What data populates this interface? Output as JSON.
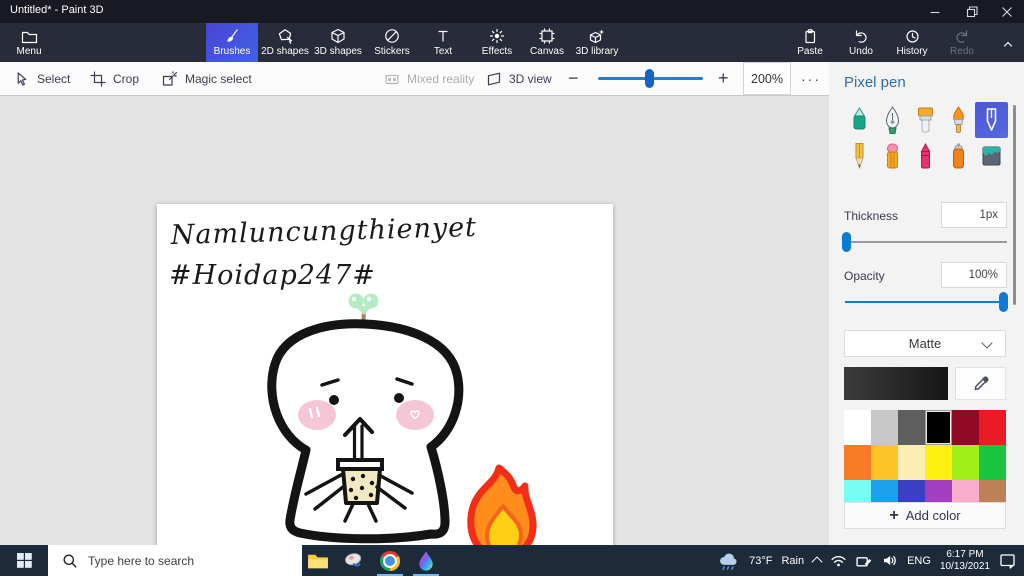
{
  "window": {
    "title": "Untitled* - Paint 3D"
  },
  "ribbon": {
    "menu_label": "Menu",
    "tools": [
      {
        "label": "Brushes",
        "icon": "brush-icon",
        "selected": true
      },
      {
        "label": "2D shapes",
        "icon": "2d-shapes-icon"
      },
      {
        "label": "3D shapes",
        "icon": "3d-shapes-icon"
      },
      {
        "label": "Stickers",
        "icon": "stickers-icon"
      },
      {
        "label": "Text",
        "icon": "text-icon"
      },
      {
        "label": "Effects",
        "icon": "effects-icon"
      },
      {
        "label": "Canvas",
        "icon": "canvas-icon"
      },
      {
        "label": "3D library",
        "icon": "3d-library-icon"
      }
    ],
    "paste_label": "Paste",
    "undo_label": "Undo",
    "history_label": "History",
    "redo_label": "Redo"
  },
  "toolbar": {
    "select_label": "Select",
    "crop_label": "Crop",
    "magic_label": "Magic select",
    "mixed_label": "Mixed reality",
    "view3d_label": "3D view",
    "zoom_value": "200%",
    "zoom_out_glyph": "−",
    "zoom_in_glyph": "+",
    "more_glyph": "···"
  },
  "canvas": {
    "line1": "Namluncungthienyet",
    "line2": "#Hoidap247#"
  },
  "panel": {
    "title": "Pixel pen",
    "brush_icons": [
      "marker",
      "calligraphy-pen",
      "paint-brush",
      "oil-brush",
      "pixel-pen",
      "pencil",
      "eraser",
      "crayon",
      "spray-can",
      "fill-bucket"
    ],
    "selected_brush": "pixel-pen",
    "thickness_label": "Thickness",
    "thickness_value": "1px",
    "opacity_label": "Opacity",
    "opacity_value": "100%",
    "material_value": "Matte",
    "current_color": "#1f1f1f",
    "palette": [
      "#ffffff",
      "#c7c7c7",
      "#5e5e5e",
      "#000000",
      "#8f0b23",
      "#ea1b24",
      "#f97a26",
      "#fdc426",
      "#fbedb3",
      "#fef00f",
      "#9ff019",
      "#19c53c",
      "#79fcf1",
      "#19a1ec",
      "#3b3fc2",
      "#a33ec1",
      "#fbaecc",
      "#bc8159"
    ],
    "selected_color_index": 3,
    "add_color_plus": "+",
    "add_color_label": "Add color"
  },
  "taskbar": {
    "search_placeholder": "Type here to search",
    "apps": [
      "file-explorer",
      "pinned-app",
      "chrome",
      "paint-3d"
    ],
    "tray": {
      "temp": "73°F",
      "weather": "Rain",
      "lang": "ENG",
      "time": "6:17 PM",
      "date": "10/13/2021"
    }
  }
}
